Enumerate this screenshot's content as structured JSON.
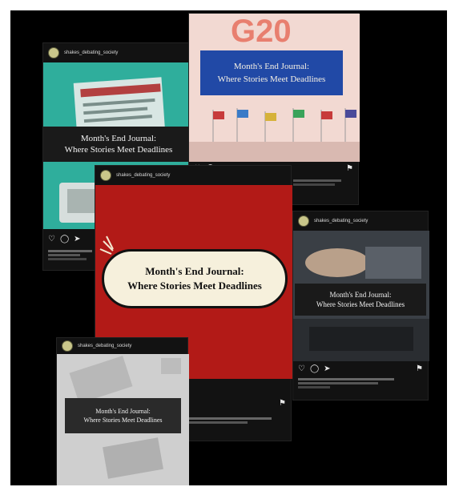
{
  "account": "shakes_debating_society",
  "journal": {
    "line1": "Month's End Journal:",
    "line2": "Where Stories Meet Deadlines"
  },
  "g20": {
    "logo": "G20",
    "line1": "Month's End Journal:",
    "line2": "Where Stories Meet Deadlines"
  },
  "icons": {
    "like": "heart-icon",
    "comment": "comment-icon",
    "share": "share-icon",
    "save": "bookmark-icon"
  },
  "colors": {
    "teal": "#2fae9c",
    "red": "#b21a17",
    "pink": "#f2d9d2",
    "blue": "#2149a6"
  }
}
